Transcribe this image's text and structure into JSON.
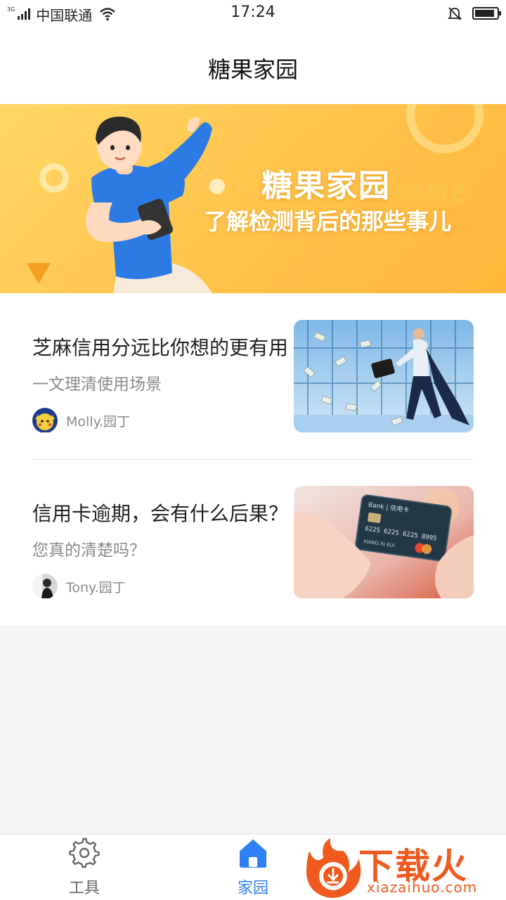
{
  "status_bar": {
    "network_type": "3G",
    "carrier": "中国联通",
    "time": "17:24",
    "icons": [
      "signal-icon",
      "wifi-icon",
      "silent-bell-icon",
      "battery-icon"
    ],
    "battery_level": 0.9
  },
  "header": {
    "title": "糖果家园"
  },
  "banner": {
    "title": "糖果家园",
    "watermark": "CANDY HOME",
    "subtitle": "了解检测背后的那些事儿",
    "colors": {
      "from": "#ffd765",
      "to": "#ffb63a"
    }
  },
  "articles": [
    {
      "title": "芝麻信用分远比你想的更有用",
      "subtitle": "一文理清使用场景",
      "author": "Molly.园丁"
    },
    {
      "title": "信用卡逾期，会有什么后果？",
      "subtitle": "您真的清楚吗？",
      "author": "Tony.园丁"
    }
  ],
  "tabbar": {
    "tabs": [
      {
        "label": "工具",
        "icon": "gear-icon",
        "active": false
      },
      {
        "label": "家园",
        "icon": "home-icon",
        "active": true
      }
    ],
    "active_color": "#2f80f2",
    "inactive_color": "#666666"
  },
  "site_logo": {
    "text": "下载火",
    "url": "xiazaihuo.com"
  }
}
